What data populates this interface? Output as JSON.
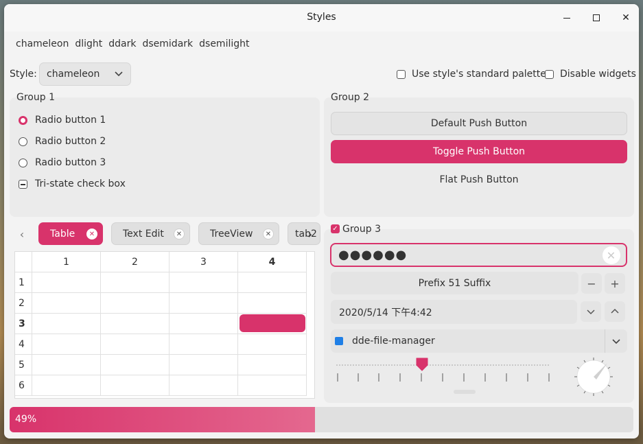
{
  "window": {
    "title": "Styles"
  },
  "style_links": [
    "chameleon",
    "dlight",
    "ddark",
    "dsemidark",
    "dsemilight"
  ],
  "style_selector": {
    "label": "Style:",
    "value": "chameleon"
  },
  "options": {
    "standard_palette": "Use style's standard palette",
    "disable_widgets": "Disable widgets"
  },
  "group1": {
    "title": "Group 1",
    "radios": [
      "Radio button 1",
      "Radio button 2",
      "Radio button 3"
    ],
    "checked_radio": "Radio button 1",
    "tristate": "Tri-state check box"
  },
  "group2": {
    "title": "Group 2",
    "default_button": "Default Push Button",
    "toggle_button": "Toggle Push Button",
    "flat_button": "Flat Push Button"
  },
  "tabs": {
    "items": [
      "Table",
      "Text Edit",
      "TreeView",
      "tab2"
    ],
    "active": "Table"
  },
  "table": {
    "columns": [
      "1",
      "2",
      "3",
      "4"
    ],
    "rows": [
      "1",
      "2",
      "3",
      "4",
      "5",
      "6"
    ],
    "current_row": "3",
    "current_column": "4"
  },
  "group3": {
    "title": "Group 3",
    "password_mask": "●●●●●●",
    "spinbox": "Prefix 51 Suffix",
    "datetime": "2020/5/14 下午4:42",
    "app_combo": "dde-file-manager"
  },
  "progress": {
    "value": 49,
    "label": "49%"
  },
  "colors": {
    "accent": "#d8336b"
  }
}
